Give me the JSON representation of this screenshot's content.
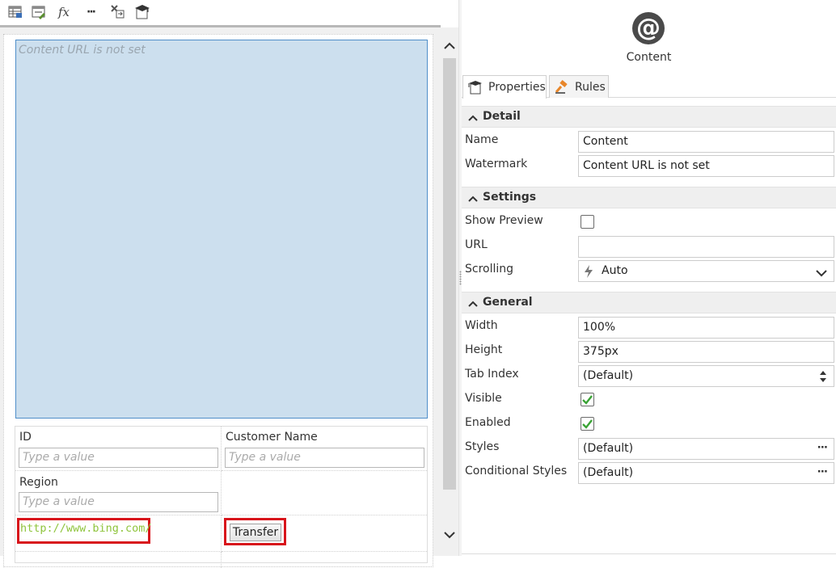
{
  "toolbar": {
    "icons": [
      "table-edit-icon",
      "form-edit-icon",
      "fx-expression-icon",
      "more-icon",
      "transfer-tool-icon",
      "wizard-cap-icon"
    ],
    "fx_label": "fx",
    "more_label": "···"
  },
  "designer": {
    "content_watermark": "Content URL is not set",
    "form": {
      "id_label": "ID",
      "id_placeholder": "Type a value",
      "customer_name_label": "Customer Name",
      "customer_name_placeholder": "Type a value",
      "region_label": "Region",
      "region_placeholder": "Type a value",
      "url_link": "http://www.bing.com/",
      "transfer_button": "Transfer"
    }
  },
  "panel": {
    "control_icon_glyph": "@",
    "control_name": "Content",
    "tabs": [
      {
        "label": "Properties",
        "active": true,
        "icon": "properties-icon"
      },
      {
        "label": "Rules",
        "active": false,
        "icon": "rules-gavel-icon"
      }
    ],
    "sections": {
      "detail": {
        "title": "Detail",
        "name_label": "Name",
        "name_value": "Content",
        "watermark_label": "Watermark",
        "watermark_value": "Content URL is not set"
      },
      "settings": {
        "title": "Settings",
        "show_preview_label": "Show Preview",
        "show_preview_checked": false,
        "url_label": "URL",
        "url_value": "",
        "scrolling_label": "Scrolling",
        "scrolling_value": "Auto"
      },
      "general": {
        "title": "General",
        "width_label": "Width",
        "width_value": "100%",
        "height_label": "Height",
        "height_value": "375px",
        "tab_index_label": "Tab Index",
        "tab_index_value": "(Default)",
        "visible_label": "Visible",
        "visible_checked": true,
        "enabled_label": "Enabled",
        "enabled_checked": true,
        "styles_label": "Styles",
        "styles_value": "(Default)",
        "conditional_styles_label": "Conditional Styles",
        "conditional_styles_value": "(Default)",
        "ellipsis": "···"
      }
    }
  },
  "colors": {
    "content_fill": "#ccdfee",
    "content_border": "#4f8ec9",
    "highlight_red": "#d8141b",
    "link_green": "#8fc43c",
    "check_green": "#3aa335"
  }
}
